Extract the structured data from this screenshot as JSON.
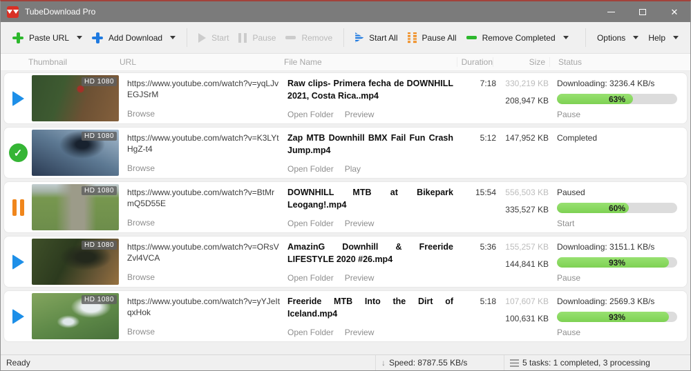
{
  "window": {
    "title": "TubeDownload Pro",
    "close_glyph": "✕"
  },
  "toolbar": {
    "paste_url": "Paste URL",
    "add_download": "Add Download",
    "start": "Start",
    "pause": "Pause",
    "remove": "Remove",
    "start_all": "Start All",
    "pause_all": "Pause All",
    "remove_completed": "Remove Completed",
    "options": "Options",
    "help": "Help"
  },
  "header": {
    "thumbnail": "Thumbnail",
    "url": "URL",
    "file_name": "File Name",
    "duration": "Duration",
    "size": "Size",
    "status": "Status"
  },
  "rows": [
    {
      "state": "downloading",
      "hd": "HD 1080",
      "url": "https://www.youtube.com/watch?v=yqLJvEGJSrM",
      "browse": "Browse",
      "name": "Raw clips- Primera fecha de DOWNHILL 2021, Costa Rica..mp4",
      "link1": "Open Folder",
      "link2": "Preview",
      "duration": "7:18",
      "size_total": "330,219 KB",
      "size_done": "208,947 KB",
      "status": "Downloading: 3236.4 KB/s",
      "progress": 63,
      "progress_label": "63%",
      "action": "Pause"
    },
    {
      "state": "completed",
      "hd": "HD 1080",
      "url": "https://www.youtube.com/watch?v=K3LYtHgZ-t4",
      "browse": "Browse",
      "name": "Zap MTB Downhill BMX Fail Fun Crash Jump.mp4",
      "link1": "Open Folder",
      "link2": "Play",
      "duration": "5:12",
      "size_done": "147,952 KB",
      "status": "Completed"
    },
    {
      "state": "paused",
      "hd": "HD 1080",
      "url": "https://www.youtube.com/watch?v=BtMrmQ5D55E",
      "browse": "Browse",
      "name": "DOWNHILL MTB at Bikepark Leogang!.mp4",
      "link1": "Open Folder",
      "link2": "Preview",
      "duration": "15:54",
      "size_total": "556,503 KB",
      "size_done": "335,527 KB",
      "status": "Paused",
      "progress": 60,
      "progress_label": "60%",
      "action": "Start"
    },
    {
      "state": "downloading",
      "hd": "HD 1080",
      "url": "https://www.youtube.com/watch?v=ORsVZvl4VCA",
      "browse": "Browse",
      "name": "AmazinG Downhill & Freeride LIFESTYLE 2020 #26.mp4",
      "link1": "Open Folder",
      "link2": "Preview",
      "duration": "5:36",
      "size_total": "155,257 KB",
      "size_done": "144,841 KB",
      "status": "Downloading: 3151.1 KB/s",
      "progress": 93,
      "progress_label": "93%",
      "action": "Pause"
    },
    {
      "state": "downloading",
      "hd": "HD 1080",
      "url": "https://www.youtube.com/watch?v=yYJeItqxHok",
      "browse": "Browse",
      "name": "Freeride MTB Into the Dirt of Iceland.mp4",
      "link1": "Open Folder",
      "link2": "Preview",
      "duration": "5:18",
      "size_total": "107,607 KB",
      "size_done": "100,631 KB",
      "status": "Downloading: 2569.3 KB/s",
      "progress": 93,
      "progress_label": "93%",
      "action": "Pause"
    }
  ],
  "statusbar": {
    "ready": "Ready",
    "speed_arrow": "↓",
    "speed": "Speed: 8787.55 KB/s",
    "tasks": "5 tasks: 1 completed, 3 processing"
  },
  "colors": {
    "title_bar": "#7b7b7b",
    "app_icon_red": "#d93025",
    "paste_green": "#2db82d",
    "add_blue": "#1f7ae0",
    "pause_orange": "#f0861c",
    "progress_green": "#7ed153",
    "progress_track": "#dcdcdc"
  }
}
